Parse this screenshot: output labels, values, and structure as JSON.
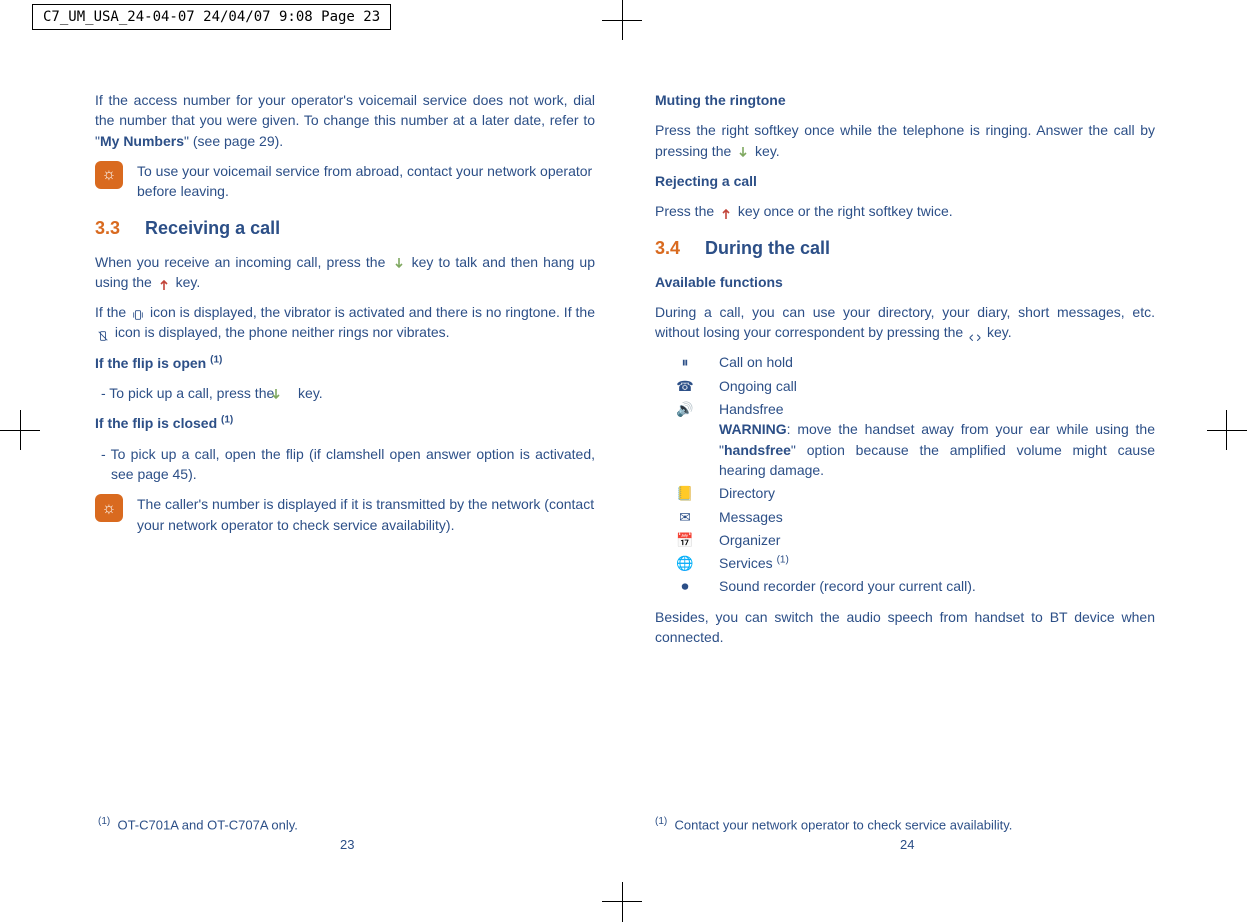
{
  "print_header": "C7_UM_USA_24-04-07  24/04/07  9:08  Page 23",
  "left": {
    "intro": "If the access number for your operator's voicemail service does not work, dial the number that you were given. To change this number at a later date, refer to \"",
    "intro_bold": "My Numbers",
    "intro_tail": "\" (see page 29).",
    "tip1": "To use your voicemail service from abroad, contact your network operator before leaving.",
    "sec_num": "3.3",
    "sec_title": "Receiving a call",
    "p1a": "When you receive an incoming call, press the ",
    "p1b": " key to talk and then hang up using the ",
    "p1c": " key.",
    "p2a": "If the ",
    "p2b": " icon is displayed, the vibrator is activated and there is no ringtone. If the ",
    "p2c": " icon is displayed, the phone neither rings nor vibrates.",
    "h_flip_open": "If the flip is open ",
    "flip_open_item": "-  To pick up a call, press the ",
    "flip_open_item_tail": " key.",
    "h_flip_closed": "If the flip is closed ",
    "flip_closed_item": "-  To pick up a call, open the flip (if clamshell open answer option is activated, see page 45).",
    "tip2": "The caller's number is displayed if it is transmitted by the network (contact your network operator to check service availability).",
    "footnote_marker": "(1)",
    "footnote": "OT-C701A and OT-C707A only.",
    "pagenum": "23"
  },
  "right": {
    "h_mute": "Muting the ringtone",
    "mute_a": "Press the right softkey once while the telephone is ringing. Answer the call by pressing the ",
    "mute_b": " key.",
    "h_reject": "Rejecting a call",
    "reject_a": "Press the ",
    "reject_b": " key once or the right softkey twice.",
    "sec_num": "3.4",
    "sec_title": "During the call",
    "h_avail": "Available functions",
    "avail_a": "During a call, you can use your directory, your diary, short messages, etc. without losing your correspondent by pressing the ",
    "avail_b": " key.",
    "funcs": {
      "f1": "Call on hold",
      "f2": "Ongoing call",
      "f3_head": "Handsfree",
      "f3_warn": "WARNING",
      "f3_body": ": move the handset away from your ear while using the \"",
      "f3_bold": "handsfree",
      "f3_tail": "\" option because the amplified volume might cause hearing damage.",
      "f4": "Directory",
      "f5": "Messages",
      "f6": "Organizer",
      "f7": "Services ",
      "f8": "Sound recorder (record your current call)."
    },
    "besides": "Besides, you can switch the audio speech from handset to BT device when connected.",
    "footnote_marker": "(1)",
    "footnote": "Contact your network operator to check service availability.",
    "pagenum": "24"
  }
}
